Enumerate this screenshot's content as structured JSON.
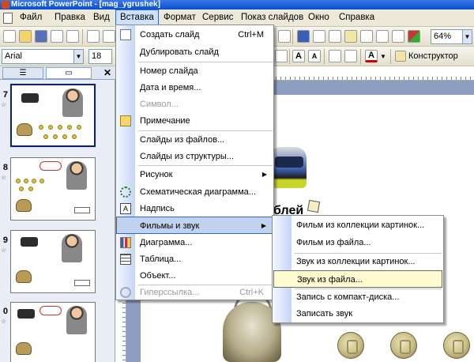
{
  "window": {
    "title": "Microsoft PowerPoint - [mag_ygrushek]"
  },
  "menubar": {
    "items": [
      {
        "label": "Файл"
      },
      {
        "label": "Правка"
      },
      {
        "label": "Вид"
      },
      {
        "label": "Вставка",
        "active": true
      },
      {
        "label": "Формат"
      },
      {
        "label": "Сервис"
      },
      {
        "label": "Показ слайдов"
      },
      {
        "label": "Окно"
      },
      {
        "label": "Справка"
      }
    ]
  },
  "toolbar": {
    "zoom": "64%",
    "font_name": "Arial",
    "font_size": "18",
    "designer_label": "Конструктор"
  },
  "slides_pane": {
    "slide_numbers": [
      "7",
      "8",
      "9",
      "0"
    ]
  },
  "slide": {
    "caption": "блей"
  },
  "insert_menu": {
    "items": [
      {
        "label": "Создать слайд",
        "shortcut": "Ctrl+M"
      },
      {
        "label": "Дублировать слайд"
      },
      {
        "label": "Номер слайда"
      },
      {
        "label": "Дата и время..."
      },
      {
        "label": "Символ...",
        "disabled": true
      },
      {
        "label": "Примечание"
      },
      {
        "label": "Слайды из файлов..."
      },
      {
        "label": "Слайды из структуры..."
      },
      {
        "label": "Рисунок",
        "submenu": true
      },
      {
        "label": "Схематическая диаграмма..."
      },
      {
        "label": "Надпись"
      },
      {
        "label": "Фильмы и звук",
        "submenu": true,
        "highlighted": true
      },
      {
        "label": "Диаграмма..."
      },
      {
        "label": "Таблица..."
      },
      {
        "label": "Объект..."
      },
      {
        "label": "Гиперссылка...",
        "shortcut": "Ctrl+K",
        "disabled": true
      }
    ]
  },
  "movies_sound_menu": {
    "items": [
      {
        "label": "Фильм из коллекции картинок..."
      },
      {
        "label": "Фильм из файла..."
      },
      {
        "label": "Звук из коллекции картинок..."
      },
      {
        "label": "Звук из файла...",
        "highlighted": true
      },
      {
        "label": "Запись с компакт-диска..."
      },
      {
        "label": "Записать звук"
      }
    ]
  }
}
